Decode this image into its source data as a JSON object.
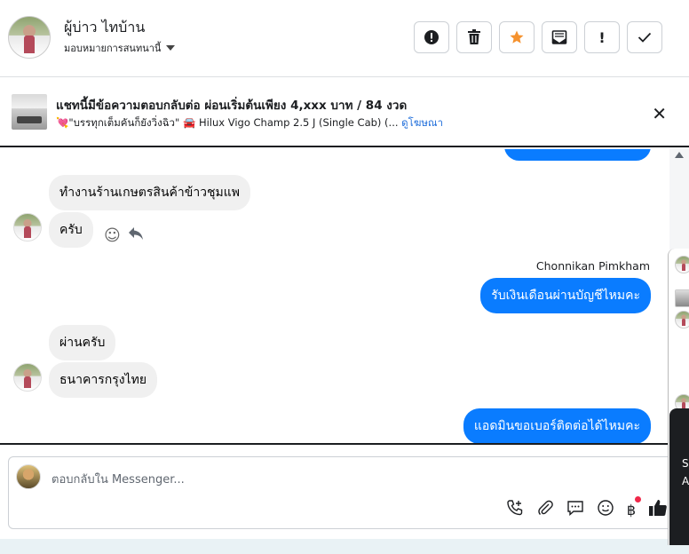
{
  "header": {
    "user_name": "ผู้บ่าว ไทบ้าน",
    "assign_label": "มอบหมายการสนทนานี้",
    "toolbar": [
      "!",
      "🗑",
      "★",
      "✉",
      "!",
      "✓"
    ]
  },
  "ad": {
    "title": "แชทนี้มีข้อความตอบกลับต่อ ผ่อนเริ่มต้นเพียง 4,xxx บาท / 84 งวด",
    "subtitle": "💘\"บรรทุกเต็มคันก็ยังวิ่งฉิว\" 🚘 Hilux Vigo Champ 2.5 J (Single Cab) (... ",
    "link": "ดูโฆษณา"
  },
  "messages": [
    {
      "text": "ทำงานร้านเกษตรสินค้าข้าวชุมแพ",
      "side": "in"
    },
    {
      "text": "ครับ",
      "side": "in"
    },
    {
      "sender": "Chonnikan Pimkham"
    },
    {
      "text": "รับเงินเดือนผ่านบัญชีไหมคะ",
      "side": "out"
    },
    {
      "text": "ผ่านครับ",
      "side": "in"
    },
    {
      "text": "ธนาคารกรุงไทย",
      "side": "in"
    },
    {
      "text": "แอดมินขอเบอร์ติดต่อได้ไหมคะ",
      "side": "out"
    }
  ],
  "composer": {
    "placeholder": "ตอบกลับใน Messenger..."
  },
  "side_panel": {
    "letters": [
      "S",
      "A"
    ]
  },
  "colors": {
    "outgoing_bubble": "#0a7cff",
    "incoming_bubble": "#f0f0f0",
    "star_accent": "#f5922e"
  }
}
